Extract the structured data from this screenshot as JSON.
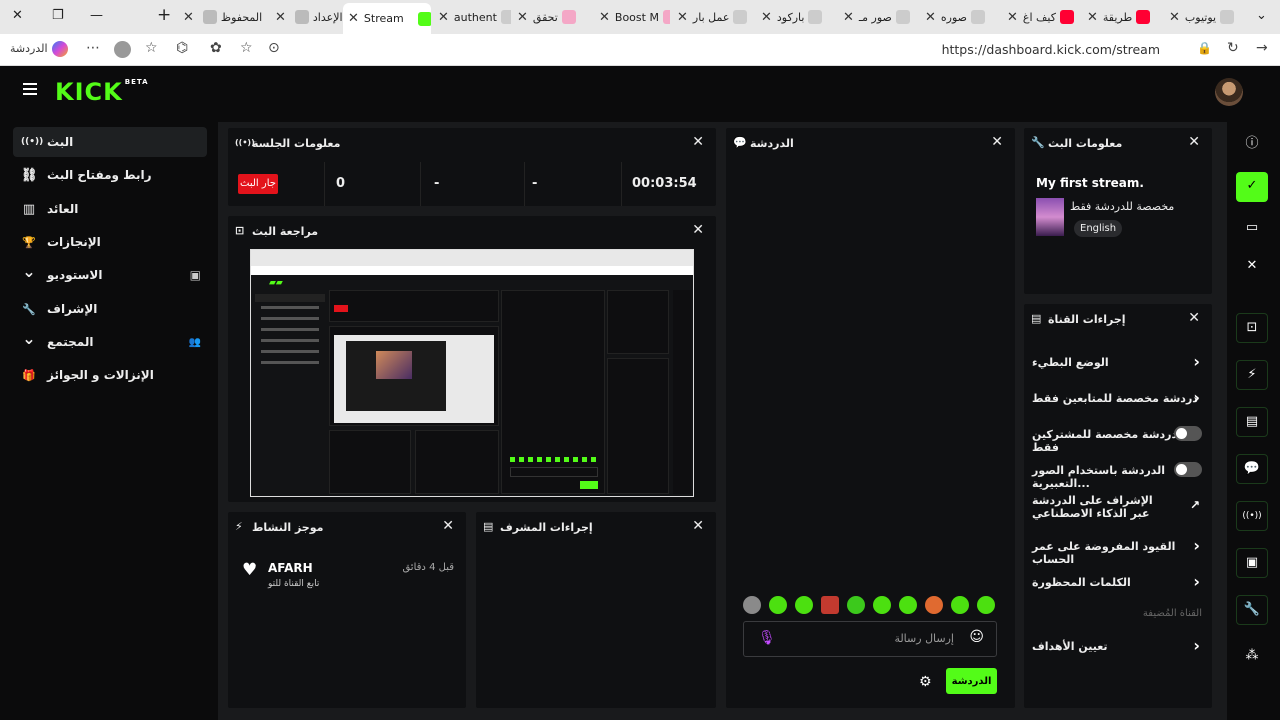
{
  "browser": {
    "tabs": [
      {
        "label": "يوتيوب",
        "color": "#e7e7e7"
      },
      {
        "label": "طريقة",
        "color": "#ff0033"
      },
      {
        "label": "كيف اغ",
        "color": "#ff0033"
      },
      {
        "label": "صوره",
        "color": "#9aa0a6"
      },
      {
        "label": "صور مـ",
        "color": "#9aa0a6"
      },
      {
        "label": "باركود",
        "color": "#9aa0a6"
      },
      {
        "label": "عمل بار",
        "color": "#9aa0a6"
      },
      {
        "label": "Boost M",
        "color": "#f4a7c6"
      },
      {
        "label": "تحقق",
        "color": "#f4a7c6"
      },
      {
        "label": "authent",
        "color": "#9aa0a6"
      },
      {
        "label": "Stream",
        "color": "#53fc18"
      },
      {
        "label": "الإعداد",
        "color": "#9aa0a6"
      },
      {
        "label": "المحفوظ",
        "color": "#9aa0a6"
      }
    ],
    "url": "https://dashboard.kick.com/stream",
    "copilot_label": "الدردشة"
  },
  "app": {
    "logo": "KICK",
    "logo_badge": "BETA"
  },
  "sidebar": {
    "items": [
      {
        "label": "البث",
        "icon": "broadcast-icon",
        "glyph": "((•))"
      },
      {
        "label": "رابط ومفتاح البث",
        "icon": "link-icon",
        "glyph": "⛓"
      },
      {
        "label": "العائد",
        "icon": "bar-chart-icon",
        "glyph": "▥"
      },
      {
        "label": "الإنجازات",
        "icon": "trophy-icon",
        "glyph": "🏆"
      },
      {
        "label": "الاستوديو",
        "icon": "chevron-down-icon",
        "glyph": "⌄",
        "right": "▣"
      },
      {
        "label": "الإشراف",
        "icon": "wrench-icon",
        "glyph": "🔧"
      },
      {
        "label": "المجتمع",
        "icon": "chevron-down-icon",
        "glyph": "⌄",
        "right": "👥"
      },
      {
        "label": "الإنزالات و الجوائز",
        "icon": "gift-icon",
        "glyph": "🎁"
      }
    ]
  },
  "session": {
    "title": "معلومات الجلسة",
    "live_label": "جار البث",
    "viewers": "0",
    "stat2": "-",
    "stat3": "-",
    "duration": "00:03:54"
  },
  "preview": {
    "title": "مراجعة البث"
  },
  "activity": {
    "title": "موجز النشاط",
    "user": "AFARH",
    "time": "قبل 4 دقائق",
    "action": "تابع القناة للتو"
  },
  "mod_actions": {
    "title": "إجراءات المشرف"
  },
  "chat": {
    "title": "الدردشة",
    "placeholder": "إرسال رسالة",
    "send_label": "الدردشة"
  },
  "stream_info": {
    "title": "معلومات البث",
    "stream_title": "My first stream.",
    "category": "مخصصة للدردشة فقط",
    "language": "English"
  },
  "channel_actions": {
    "title": "إجراءات القناة",
    "items": [
      {
        "label": "الوضع البطيء",
        "control": "chevron"
      },
      {
        "label": "دردشة مخصصة للمتابعين فقط",
        "control": "chevron"
      },
      {
        "label": "الدردشة مخصصة للمشتركين فقط",
        "control": "toggle"
      },
      {
        "label": "الدردشة باستخدام الصور التعبيرية...",
        "control": "toggle"
      },
      {
        "label": "الإشراف على الدردشة عبر الذكاء الاصطناعي",
        "control": "external"
      },
      {
        "label": "القيود المفروضة على عمر الحساب",
        "control": "chevron"
      },
      {
        "label": "الكلمات المحظورة",
        "control": "chevron"
      }
    ],
    "hosted_label": "القناة المُضيفة",
    "goals_label": "تعيين الأهداف"
  },
  "colors": {
    "accent": "#53fc18",
    "live": "#e3131b",
    "panel": "#0f1012",
    "background": "#191a1c"
  }
}
